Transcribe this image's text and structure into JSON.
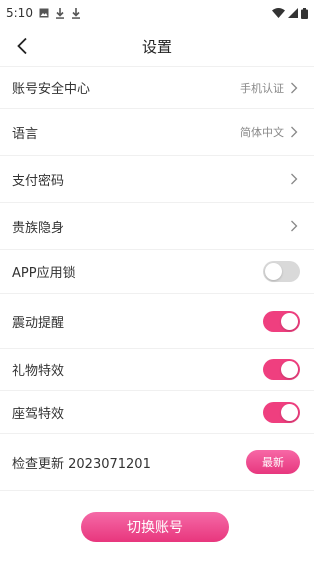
{
  "status_bar": {
    "time": "5:10",
    "icons": [
      "image-icon",
      "download-icon",
      "download-icon",
      "wifi-icon",
      "signal-icon",
      "battery-icon"
    ]
  },
  "nav": {
    "title": "设置",
    "back_icon": "chevron-left-icon"
  },
  "settings": {
    "account_security": {
      "label": "账号安全中心",
      "value": "手机认证"
    },
    "language": {
      "label": "语言",
      "value": "简体中文"
    },
    "payment_password": {
      "label": "支付密码"
    },
    "noble_invisible": {
      "label": "贵族隐身"
    },
    "app_lock": {
      "label": "APP应用锁",
      "enabled": false
    },
    "vibration": {
      "label": "震动提醒",
      "enabled": true
    },
    "gift_effects": {
      "label": "礼物特效",
      "enabled": true
    },
    "mount_effects": {
      "label": "座驾特效",
      "enabled": true
    },
    "check_update": {
      "label": "检查更新 2023071201",
      "button": "最新"
    }
  },
  "footer": {
    "switch_account": "切换账号"
  },
  "colors": {
    "accent": "#ef3f7f",
    "toggle_off": "#d9d9d9"
  }
}
